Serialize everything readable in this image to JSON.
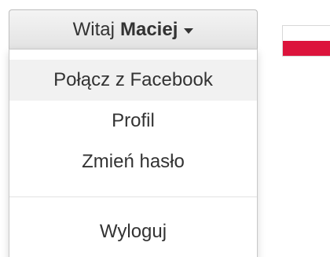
{
  "user_menu": {
    "greeting": "Witaj",
    "username": "Maciej",
    "items": [
      {
        "label": "Połącz z Facebook"
      },
      {
        "label": "Profil"
      },
      {
        "label": "Zmień hasło"
      }
    ],
    "logout_label": "Wyloguj"
  },
  "language_flag": {
    "icon": "poland-flag-icon",
    "colors": {
      "top": "#ffffff",
      "bottom": "#dc143c"
    }
  }
}
